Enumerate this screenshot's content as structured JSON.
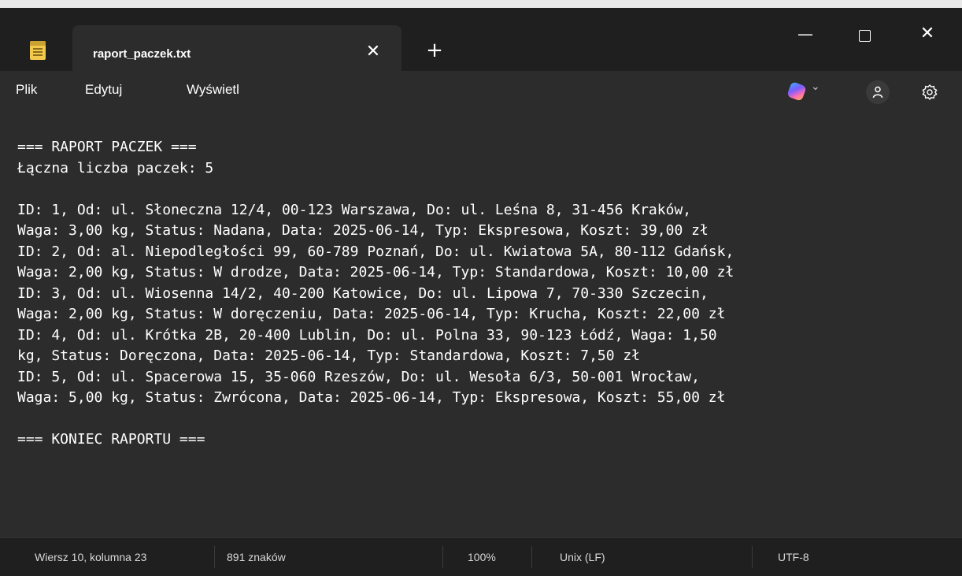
{
  "window": {
    "tab_title": "raport_paczek.txt",
    "tab_close_icon": "close-icon",
    "new_tab_label": "+",
    "minimize_label": "—",
    "close_label": "✕"
  },
  "menu": {
    "items": [
      {
        "label": "Plik"
      },
      {
        "label": "Edytuj"
      },
      {
        "label": "Wyświetl"
      }
    ],
    "copilot_chevron": "⌄"
  },
  "editor": {
    "lines": [
      "=== RAPORT PACZEK ===",
      "Łączna liczba paczek: 5",
      "",
      "ID: 1, Od: ul. Słoneczna 12/4, 00-123 Warszawa, Do: ul. Leśna 8, 31-456 Kraków,",
      "Waga: 3,00 kg, Status: Nadana, Data: 2025-06-14, Typ: Ekspresowa, Koszt: 39,00 zł",
      "ID: 2, Od: al. Niepodległości 99, 60-789 Poznań, Do: ul. Kwiatowa 5A, 80-112 Gdańsk,",
      "Waga: 2,00 kg, Status: W drodze, Data: 2025-06-14, Typ: Standardowa, Koszt: 10,00 zł",
      "ID: 3, Od: ul. Wiosenna 14/2, 40-200 Katowice, Do: ul. Lipowa 7, 70-330 Szczecin,",
      "Waga: 2,00 kg, Status: W doręczeniu, Data: 2025-06-14, Typ: Krucha, Koszt: 22,00 zł",
      "ID: 4, Od: ul. Krótka 2B, 20-400 Lublin, Do: ul. Polna 33, 90-123 Łódź, Waga: 1,50",
      "kg, Status: Doręczona, Data: 2025-06-14, Typ: Standardowa, Koszt: 7,50 zł",
      "ID: 5, Od: ul. Spacerowa 15, 35-060 Rzeszów, Do: ul. Wesoła 6/3, 50-001 Wrocław,",
      "Waga: 5,00 kg, Status: Zwrócona, Data: 2025-06-14, Typ: Ekspresowa, Koszt: 55,00 zł",
      "",
      "=== KONIEC RAPORTU ==="
    ]
  },
  "status": {
    "position": "Wiersz 10, kolumna 23",
    "chars": "891 znaków",
    "zoom": "100%",
    "line_endings": "Unix (LF)",
    "encoding": "UTF-8"
  }
}
